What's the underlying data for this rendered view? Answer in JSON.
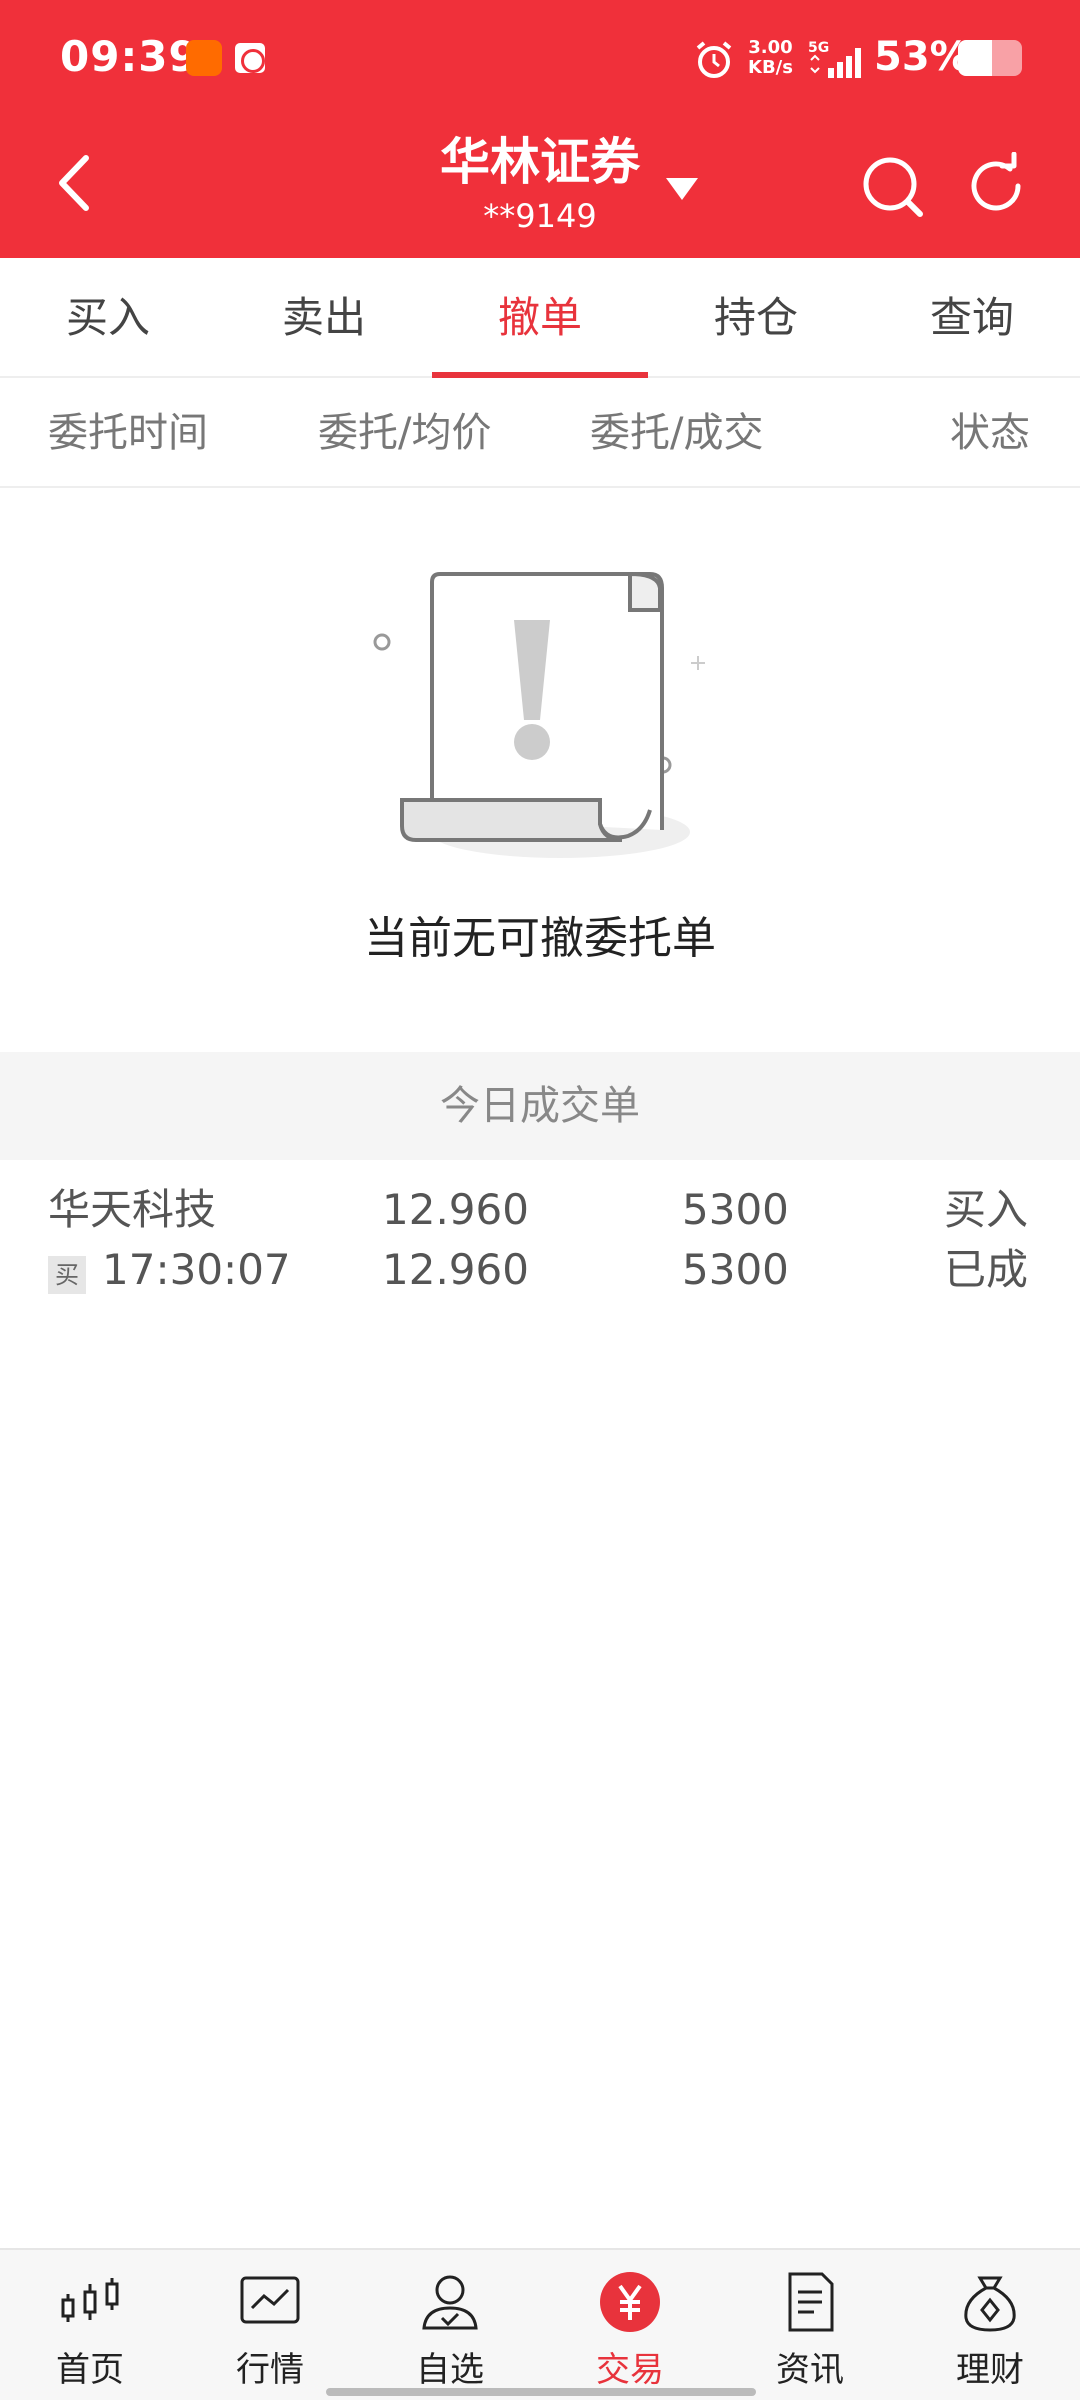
{
  "status_bar": {
    "time": "09:39",
    "net_speed_value": "3.00",
    "net_speed_unit": "KB/s",
    "network": "5G",
    "battery_percent": "53%",
    "battery_level": 0.53,
    "icons": [
      "weibo-icon",
      "bank-icon",
      "alarm-icon",
      "signal-icon",
      "battery-icon"
    ]
  },
  "header": {
    "title": "华林证券",
    "account": "**9149",
    "color": "#f0303a"
  },
  "tabs": [
    {
      "label": "买入",
      "active": false
    },
    {
      "label": "卖出",
      "active": false
    },
    {
      "label": "撤单",
      "active": true
    },
    {
      "label": "持仓",
      "active": false
    },
    {
      "label": "查询",
      "active": false
    }
  ],
  "columns": [
    "委托时间",
    "委托/均价",
    "委托/成交",
    "状态"
  ],
  "empty_state": {
    "message": "当前无可撤委托单"
  },
  "today_deals": {
    "title": "今日成交单",
    "rows": [
      {
        "name": "华天科技",
        "tag": "买",
        "time": "17:30:07",
        "order_price": "12.960",
        "avg_price": "12.960",
        "order_qty": "5300",
        "filled_qty": "5300",
        "direction": "买入",
        "status": "已成"
      }
    ]
  },
  "bottom_nav": [
    {
      "label": "首页",
      "icon": "candlestick-icon",
      "active": false
    },
    {
      "label": "行情",
      "icon": "chart-icon",
      "active": false
    },
    {
      "label": "自选",
      "icon": "user-check-icon",
      "active": false
    },
    {
      "label": "交易",
      "icon": "yuan-icon",
      "active": true
    },
    {
      "label": "资讯",
      "icon": "document-icon",
      "active": false
    },
    {
      "label": "理财",
      "icon": "money-bag-icon",
      "active": false
    }
  ],
  "accent_color": "#e8333c"
}
